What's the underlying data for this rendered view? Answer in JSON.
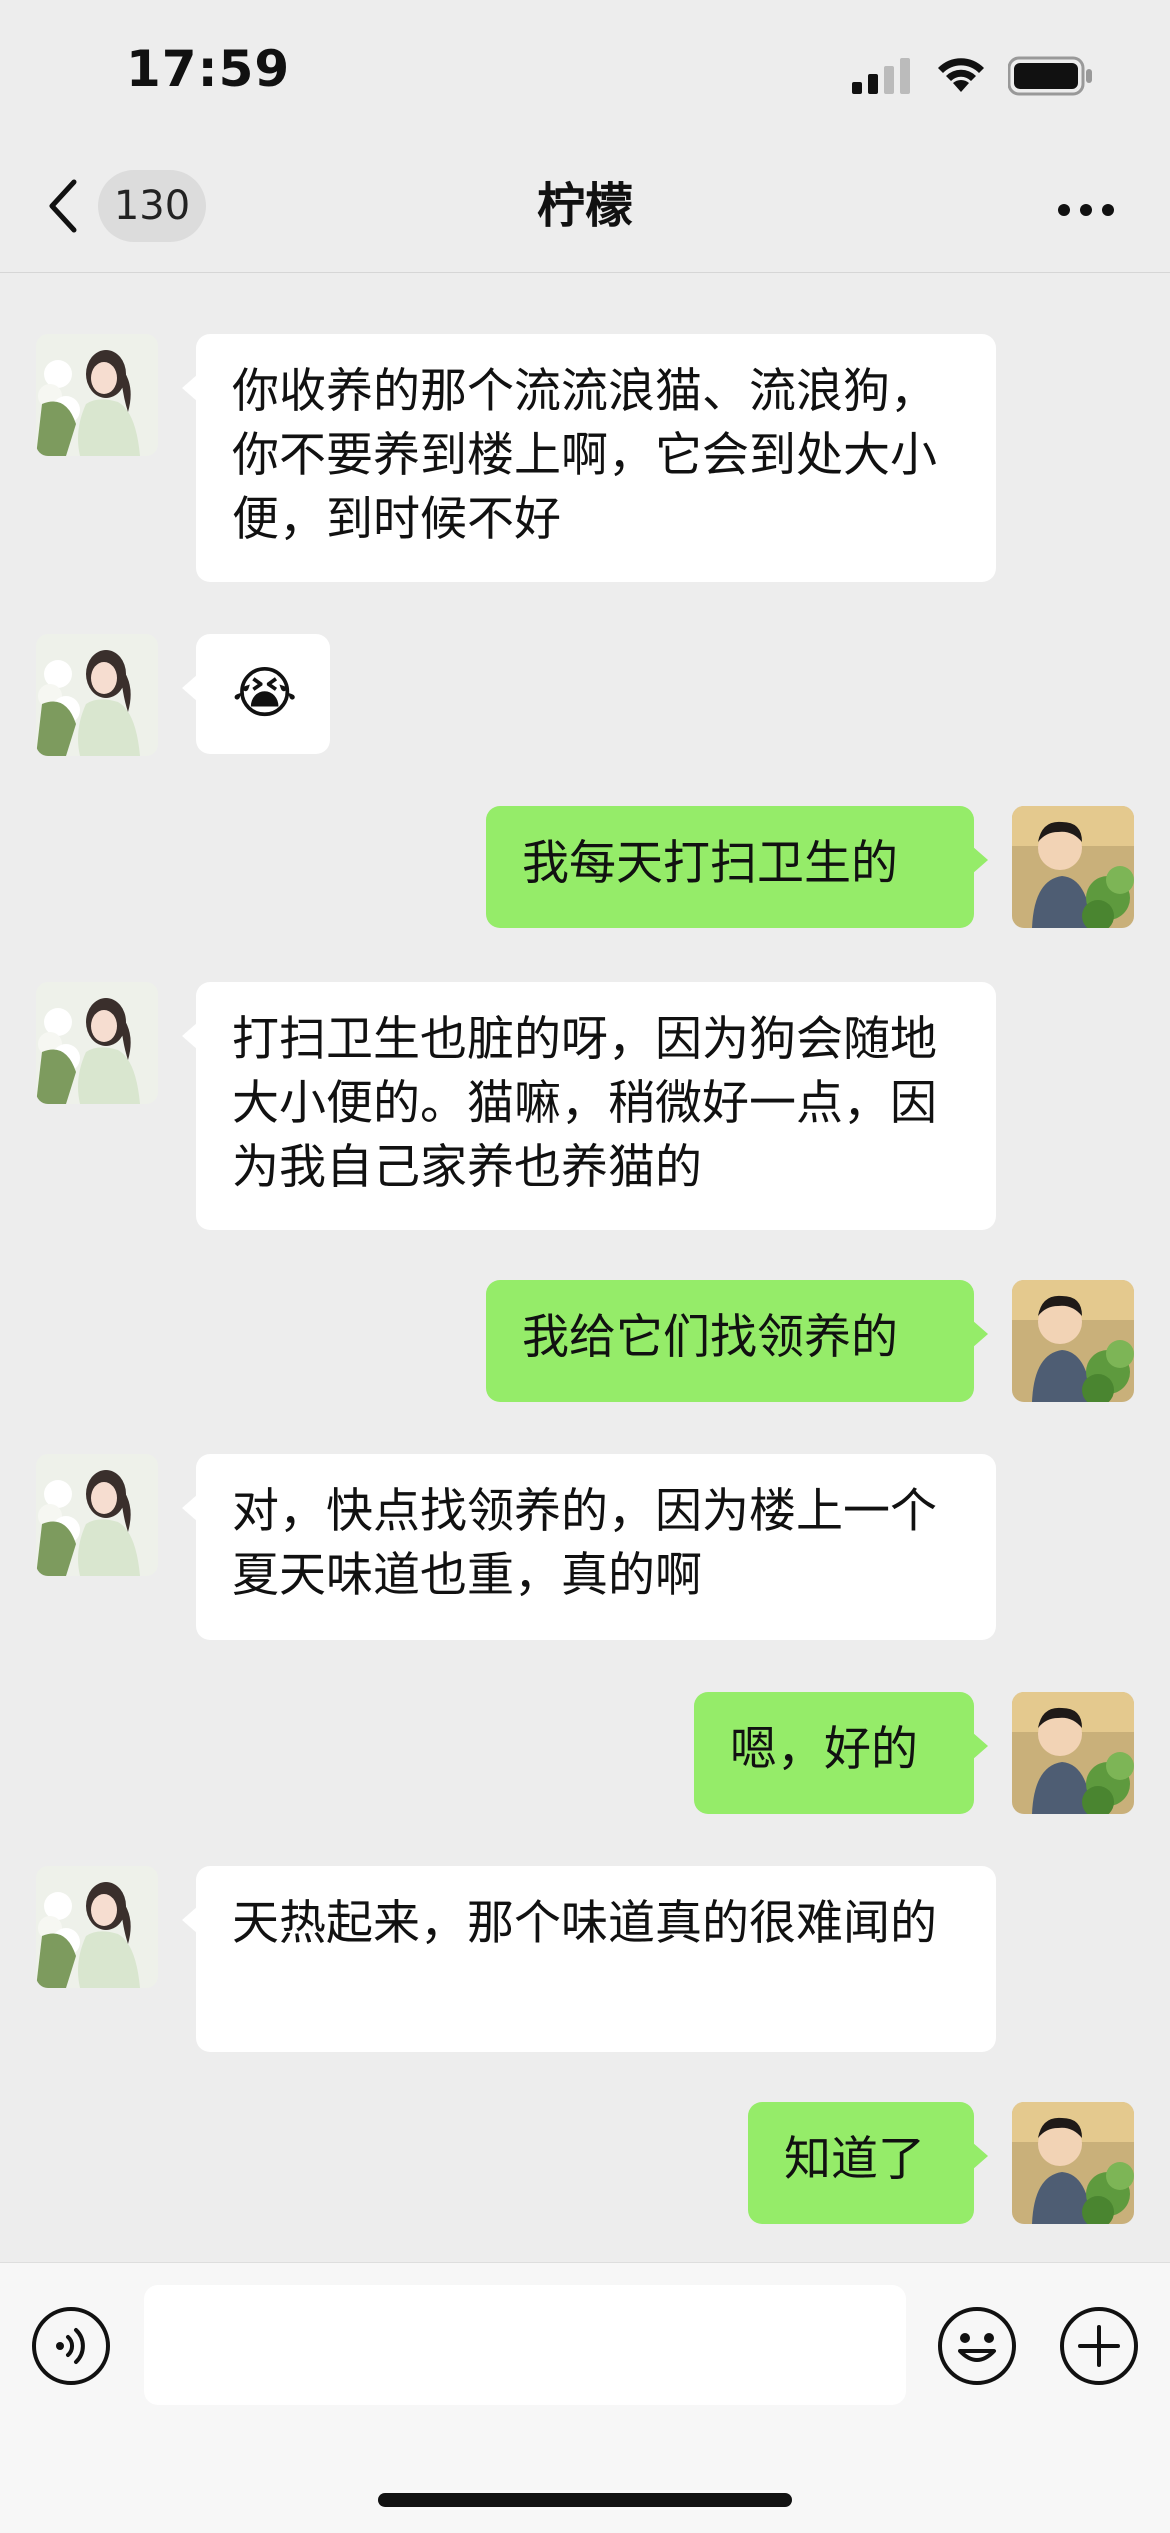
{
  "status_bar": {
    "time": "17:59"
  },
  "nav": {
    "unread_count": "130",
    "title": "柠檬"
  },
  "colors": {
    "background": "#EDEDED",
    "incoming_bubble": "#FFFFFF",
    "outgoing_bubble": "#95EC69"
  },
  "messages": [
    {
      "direction": "in",
      "text": "你收养的那个流流浪猫、流浪狗，你不要养到楼上啊，它会到处大小便，到时候不好"
    },
    {
      "direction": "in",
      "text": "😭"
    },
    {
      "direction": "out",
      "text": "我每天打扫卫生的"
    },
    {
      "direction": "in",
      "text": "打扫卫生也脏的呀，因为狗会随地大小便的。猫嘛，稍微好一点，因为我自己家养也养猫的"
    },
    {
      "direction": "out",
      "text": "我给它们找领养的"
    },
    {
      "direction": "in",
      "text": "对，快点找领养的，因为楼上一个夏天味道也重，真的啊"
    },
    {
      "direction": "out",
      "text": "嗯，好的"
    },
    {
      "direction": "in",
      "text": "天热起来，那个味道真的很难闻的"
    },
    {
      "direction": "out",
      "text": "知道了"
    }
  ],
  "input_bar": {
    "message_value": ""
  },
  "icons": {
    "back": "chevron-left-icon",
    "more": "more-dots-icon",
    "voice": "voice-icon",
    "emoji": "emoji-icon",
    "plus": "plus-icon"
  }
}
